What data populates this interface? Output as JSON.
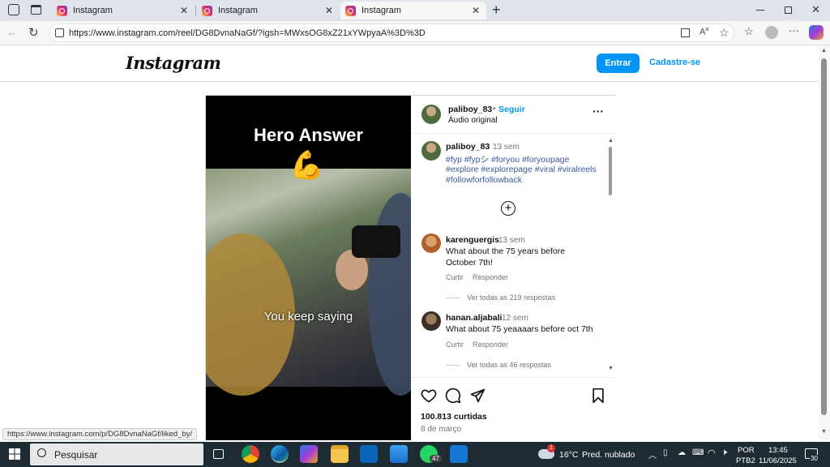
{
  "browser": {
    "tabs": [
      {
        "title": "Instagram"
      },
      {
        "title": "Instagram"
      },
      {
        "title": "Instagram"
      }
    ],
    "new_tab_symbol": "+",
    "url": "https://www.instagram.com/reel/DG8DvnaNaGf/?igsh=MWxsOG8xZ21xYWpyaA%3D%3D",
    "status_url": "https://www.instagram.com/p/DG8DvnaNaGf/liked_by/"
  },
  "instagram": {
    "logo": "Instagram",
    "login_label": "Entrar",
    "signup_label": "Cadastre-se",
    "video": {
      "title": "Hero Answer",
      "emoji": "💪",
      "caption": "You keep saying"
    },
    "post": {
      "author": "paliboy_83",
      "follow_label": "Seguir",
      "separator": "•",
      "audio": "Áudio original",
      "caption_time": "13 sem",
      "hashtags_line1": "#fyp #fypシ #foryou #foryoupage",
      "hashtags_line2": "#explore #explorepage #viral #viralreels",
      "hashtags_line3": "#followforfollowback",
      "likes": "100.813 curtidas",
      "date": "8 de março"
    },
    "comments": [
      {
        "user": "karenguergis",
        "time": "13 sem",
        "text_line1": "What about the 75 years before",
        "text_line2": "October 7th!",
        "like_label": "Curtir",
        "reply_label": "Responder",
        "view_replies": "Ver todas as 219 respostas"
      },
      {
        "user": "hanan.aljabali",
        "time": "12 sem",
        "text_line1": "What about 75 yeaaaars before oct 7th",
        "like_label": "Curtir",
        "reply_label": "Responder",
        "view_replies": "Ver todas as 46 respostas"
      }
    ]
  },
  "taskbar": {
    "search_placeholder": "Pesquisar",
    "whatsapp_badge": "47",
    "weather_temp": "16°C",
    "weather_desc": "Pred. nublado",
    "lang": "POR",
    "layout": "PTB2",
    "time": "13:45",
    "date": "11/06/2025",
    "notif_count": "30",
    "weather_badge": "1"
  }
}
